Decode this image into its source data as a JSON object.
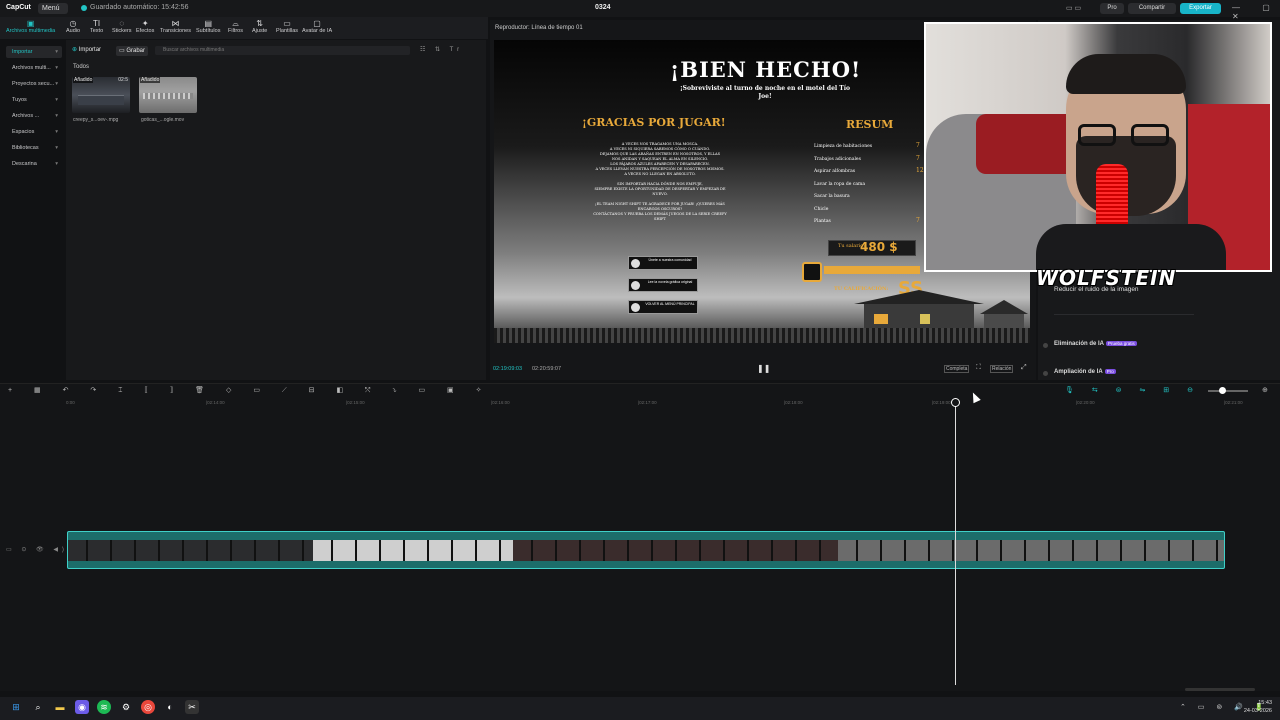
{
  "titlebar": {
    "logo": "CapCut",
    "menu_label": "Menú",
    "autosave_text": "Guardado automático: 15:42:56",
    "project_name": "0324",
    "pro_label": "Pro",
    "share_label": "Compartir",
    "export_label": "Exportar",
    "window_controls": "— ▢ ✕"
  },
  "tooltabs": [
    {
      "label": "Archivos multimedia",
      "icon": "media-icon",
      "glyph": "▣"
    },
    {
      "label": "Audio",
      "icon": "audio-icon",
      "glyph": "◷"
    },
    {
      "label": "Texto",
      "icon": "text-icon",
      "glyph": "TI"
    },
    {
      "label": "Stickers",
      "icon": "sticker-icon",
      "glyph": "◌"
    },
    {
      "label": "Efectos",
      "icon": "effects-icon",
      "glyph": "✦"
    },
    {
      "label": "Transiciones",
      "icon": "transitions-icon",
      "glyph": "⋈"
    },
    {
      "label": "Subtítulos",
      "icon": "subtitles-icon",
      "glyph": "▤"
    },
    {
      "label": "Filtros",
      "icon": "filters-icon",
      "glyph": "⌓"
    },
    {
      "label": "Ajuste",
      "icon": "adjust-icon",
      "glyph": "⇅"
    },
    {
      "label": "Plantillas",
      "icon": "templates-icon",
      "glyph": "▭"
    },
    {
      "label": "Avatar de IA",
      "icon": "ai-avatar-icon",
      "glyph": "▢"
    }
  ],
  "leftnav": [
    {
      "label": "Importar",
      "active": true
    },
    {
      "label": "Archivos multi...",
      "active": false
    },
    {
      "label": "Proyectos secu...",
      "active": false
    },
    {
      "label": "Tuyos",
      "active": false
    },
    {
      "label": "Archivos ...",
      "active": false
    },
    {
      "label": "Espacios",
      "active": false
    },
    {
      "label": "Bibliotecas",
      "active": false
    },
    {
      "label": "Descarina",
      "active": false
    }
  ],
  "media": {
    "import_tab": "Importar",
    "record_tab": "Grabar",
    "search_placeholder": "Buscar archivos multimedia",
    "tools": "☷ ⇅ Tr",
    "all_label": "Todos",
    "files": [
      {
        "name": "creepy_s...oev-.mpg",
        "badge": "Añadido",
        "duration": "02:5"
      },
      {
        "name": "goticas_...ogle.mov",
        "badge": "Añadido",
        "duration": ""
      }
    ]
  },
  "player": {
    "title": "Reproductor: Línea de tiempo 01",
    "current_time": "02:19:09:03",
    "total_time": "02:20:59:07",
    "full_label": "Completa",
    "ratio_label": "Relación"
  },
  "game_screen": {
    "headline": "¡BIEN HECHO!",
    "subtitle": "¡Sobreviviste al turno de noche en el motel del Tío Joe!",
    "thanks": "¡GRACIAS POR JUGAR!",
    "summary": "RESUM",
    "paragraph": [
      "A VECES NOS TRAGAMOS UNA MOSCA.",
      "A VECES NI SIQUIERA SABEMOS CÓMO O CUÁNDO.",
      "DEJAMOS QUE LAS ARAÑAS ENTREN EN NOSOTROS, Y ELLAS",
      "NOS ANIDAN Y SAQUEAN EL ALMA EN SILENCIO.",
      "LOS PÁJAROS AZULES APARECEN Y DESAPARECEN.",
      "A VECES LLEVAN NUESTRA PERCEPCIÓN DE NOSOTROS MISMOS.",
      "A VECES NO LLEGAN EN ABSOLUTO.",
      "",
      "SIN IMPORTAR HACIA DÓNDE NOS EMPUJE,",
      "SIEMPRE EXISTE LA OPORTUNIDAD DE DESPERTAR Y EMPEZAR DE",
      "NUEVO.",
      "",
      "¡EL TEAM NIGHT SHIFT TE AGRADECE POR JUGAR! ¡QUIERES MÁS",
      "ENCARGOS OSCUROS?",
      "CONTÁCTANOS Y PRUEBA LOS DEMÁS JUEGOS DE LA SERIE CREEPY",
      "SHIFT"
    ],
    "buttons": [
      "Únete a nuestra comunidad",
      "Lee la novela gráfica original",
      "VOLVER AL MENÚ PRINCIPAL"
    ],
    "stats": [
      "Limpieza de habitaciones",
      "Trabajos adicionales",
      "Aspirar alfombras",
      "Lavar la ropa de cama",
      "Sacar la basura",
      "Chicle",
      "Plantas"
    ],
    "stat_values": [
      "7",
      "7",
      "12",
      "",
      "",
      "",
      "7"
    ],
    "salary_label": "Tu salario:",
    "salary_value": "480 $",
    "rating_label": "TU CALIFICACIÓN:",
    "rating_value": "SS"
  },
  "rightpanel": {
    "reduce_noise": "Reducir el ruido de la imagen",
    "ai_remove_label": "Eliminación de IA",
    "ai_remove_tag": "Prueba gratis",
    "ai_upscale_label": "Ampliación de IA",
    "ai_upscale_tag": "Pro"
  },
  "overlay": {
    "streamer_name": "WOLFSTEIN"
  },
  "timeline": {
    "toolbar_icons": "+ ▦ ↶ ↷ ⌶ ⟦ ⟧ 🗑 ◇ ▭ ⟋ ⊟ ◧ ⤲ ⤵ ▭ ▣ ✧",
    "right_tools": "🎙 ⇆ ⊜ ⇋ ⊞ ⊖",
    "ticks": [
      "0:00",
      "|02:14:00",
      "|02:15:00",
      "|02:16:00",
      "|02:17:00",
      "|02:18:00",
      "|02:19:00",
      "|02:20:00",
      "|02:21:00"
    ],
    "track_head": "▭ ⊙ 👁 ◀)",
    "zoom_fraction": 0.35
  },
  "taskbar": {
    "tray": "⌃ ▭ ⊚ 🔊 🔋",
    "time": "15:43",
    "date": "24-03-2026"
  },
  "colors": {
    "accent": "#22c4c4",
    "export": "#18b4c8",
    "clip": "#1c6d6a",
    "gold": "#e8a93a",
    "ai_tag": "#7a4de0"
  }
}
